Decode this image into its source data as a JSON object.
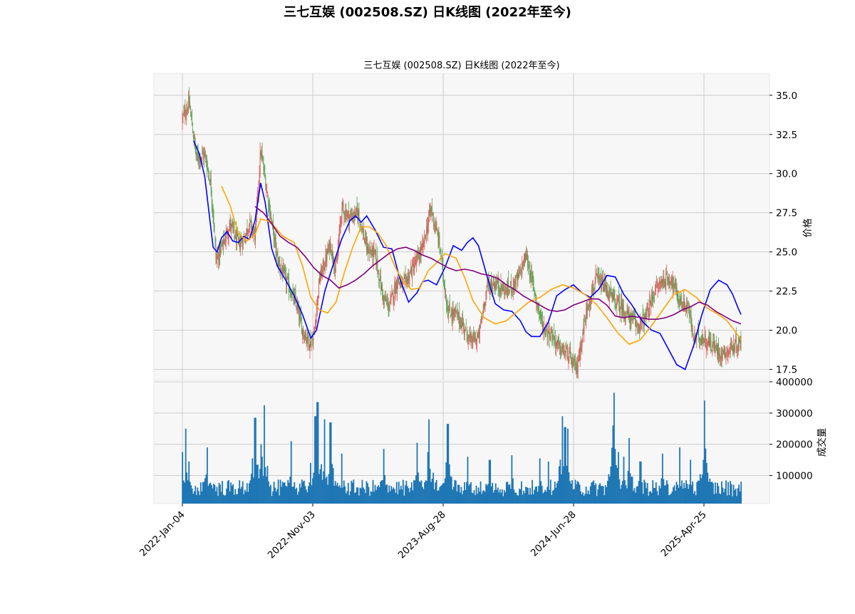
{
  "figure": {
    "suptitle": "三七互娱 (002508.SZ) 日K线图 (2022年至今)"
  },
  "colors": {
    "up": "#e15759",
    "down": "#59a14f",
    "ma_short": "#0000ff",
    "ma_mid": "#ffa500",
    "ma_long": "#800080",
    "volume": "#1f77b4",
    "panel_bg": "#f7f7f7",
    "grid": "#cccccc"
  },
  "chart_data": [
    {
      "type": "candlestick",
      "title": "三七互娱 (002508.SZ) 日K线图 (2022年至今)",
      "ylabel": "价格",
      "ylim": [
        16.8,
        36.4
      ],
      "yticks": [
        17.5,
        20.0,
        22.5,
        25.0,
        27.5,
        30.0,
        32.5,
        35.0
      ],
      "ytick_labels": [
        "17.5",
        "20.0",
        "22.5",
        "25.0",
        "27.5",
        "30.0",
        "32.5",
        "35.0"
      ],
      "grid": true,
      "x_labels": [
        "2022-Jan-04",
        "2022-Nov-03",
        "2023-Aug-28",
        "2024-Jun-28",
        "2025-Apr-25"
      ],
      "close_series": {
        "name": "close",
        "t": [
          0,
          0.012,
          0.025,
          0.04,
          0.05,
          0.055,
          0.06,
          0.07,
          0.085,
          0.1,
          0.11,
          0.12,
          0.13,
          0.14,
          0.155,
          0.17,
          0.19,
          0.205,
          0.215,
          0.228,
          0.235,
          0.245,
          0.265,
          0.275,
          0.285,
          0.3,
          0.315,
          0.33,
          0.345,
          0.36,
          0.37,
          0.385,
          0.395,
          0.41,
          0.43,
          0.445,
          0.46,
          0.475,
          0.49,
          0.505,
          0.515,
          0.53,
          0.545,
          0.56,
          0.58,
          0.6,
          0.615,
          0.63,
          0.645,
          0.66,
          0.675,
          0.69,
          0.705,
          0.725,
          0.74,
          0.755,
          0.77,
          0.785,
          0.8,
          0.815,
          0.83,
          0.845,
          0.86,
          0.875,
          0.89,
          0.905,
          0.915,
          0.925,
          0.935,
          0.95,
          0.965,
          0.98,
          1.0
        ],
        "values": [
          33.5,
          34.5,
          31.0,
          31.2,
          29.5,
          27.5,
          24.5,
          25.2,
          26.8,
          25.5,
          25.8,
          26.9,
          26.0,
          31.5,
          28.0,
          24.5,
          22.8,
          21.5,
          20.0,
          19.2,
          19.5,
          23.2,
          25.5,
          23.8,
          27.8,
          27.2,
          27.5,
          25.2,
          24.8,
          22.0,
          21.5,
          23.2,
          22.8,
          23.8,
          25.2,
          27.8,
          25.5,
          21.2,
          21.0,
          20.2,
          19.3,
          19.5,
          22.8,
          23.0,
          22.5,
          23.2,
          24.8,
          22.5,
          20.2,
          19.8,
          18.8,
          18.5,
          17.4,
          21.5,
          23.2,
          22.8,
          22.0,
          21.5,
          20.8,
          20.3,
          20.8,
          22.5,
          23.2,
          23.3,
          21.8,
          21.5,
          19.5,
          19.6,
          19.4,
          19.0,
          18.5,
          18.8,
          19.2
        ]
      },
      "series": [
        {
          "color": "#0000ff",
          "t": [
            0.02,
            0.03,
            0.04,
            0.05,
            0.055,
            0.062,
            0.07,
            0.08,
            0.09,
            0.1,
            0.11,
            0.12,
            0.13,
            0.14,
            0.148,
            0.16,
            0.17,
            0.185,
            0.2,
            0.215,
            0.23,
            0.24,
            0.255,
            0.27,
            0.285,
            0.3,
            0.31,
            0.32,
            0.33,
            0.345,
            0.36,
            0.375,
            0.39,
            0.405,
            0.42,
            0.43,
            0.44,
            0.455,
            0.47,
            0.485,
            0.5,
            0.51,
            0.52,
            0.53,
            0.545,
            0.56,
            0.575,
            0.59,
            0.605,
            0.615,
            0.625,
            0.64,
            0.655,
            0.67,
            0.685,
            0.7,
            0.715,
            0.73,
            0.745,
            0.76,
            0.775,
            0.79,
            0.805,
            0.815,
            0.825,
            0.84,
            0.855,
            0.87,
            0.885,
            0.9,
            0.915,
            0.93,
            0.945,
            0.96,
            0.975,
            0.985,
            0.995,
            1.0
          ],
          "values": [
            32.1,
            31.3,
            29.8,
            26.8,
            25.3,
            25.0,
            25.9,
            26.3,
            25.7,
            25.6,
            26.0,
            25.8,
            27.0,
            29.4,
            28.2,
            25.2,
            24.1,
            23.2,
            22.2,
            21.0,
            19.5,
            20.0,
            22.5,
            24.2,
            25.8,
            27.0,
            27.3,
            26.9,
            27.3,
            26.4,
            25.3,
            25.2,
            23.2,
            21.8,
            22.4,
            23.1,
            23.2,
            22.9,
            24.0,
            25.4,
            25.1,
            25.6,
            25.9,
            25.4,
            23.5,
            21.7,
            21.3,
            21.2,
            20.6,
            19.9,
            19.6,
            19.6,
            20.5,
            22.2,
            22.6,
            22.9,
            22.4,
            22.1,
            22.6,
            23.5,
            23.4,
            22.3,
            21.6,
            21.0,
            20.5,
            20.0,
            19.8,
            18.8,
            17.8,
            17.5,
            19.0,
            21.0,
            22.6,
            23.2,
            22.9,
            22.3,
            21.4,
            21.0
          ],
          "name": ""
        },
        {
          "color": "#ffa500",
          "t": [
            0.07,
            0.085,
            0.1,
            0.115,
            0.13,
            0.14,
            0.152,
            0.165,
            0.18,
            0.2,
            0.215,
            0.23,
            0.245,
            0.26,
            0.275,
            0.29,
            0.305,
            0.32,
            0.335,
            0.35,
            0.365,
            0.38,
            0.395,
            0.41,
            0.425,
            0.44,
            0.455,
            0.47,
            0.49,
            0.505,
            0.52,
            0.54,
            0.56,
            0.58,
            0.6,
            0.62,
            0.64,
            0.66,
            0.68,
            0.7,
            0.72,
            0.74,
            0.76,
            0.78,
            0.8,
            0.82,
            0.84,
            0.86,
            0.88,
            0.9,
            0.92,
            0.94,
            0.96,
            0.975,
            0.99,
            1.0
          ],
          "values": [
            29.2,
            28.0,
            26.2,
            25.7,
            26.1,
            27.1,
            27.0,
            26.6,
            26.0,
            25.6,
            24.1,
            22.1,
            21.3,
            21.1,
            21.8,
            23.7,
            25.3,
            26.6,
            26.6,
            26.2,
            25.4,
            24.1,
            23.1,
            22.6,
            22.7,
            23.8,
            24.3,
            24.9,
            24.6,
            23.4,
            21.9,
            20.8,
            20.4,
            20.6,
            21.2,
            21.8,
            22.1,
            22.6,
            22.9,
            22.7,
            22.3,
            21.7,
            20.8,
            19.8,
            19.1,
            19.4,
            20.3,
            21.3,
            22.3,
            22.6,
            22.1,
            21.4,
            21.0,
            20.6,
            19.9,
            19.4
          ],
          "name": ""
        },
        {
          "color": "#800080",
          "t": [
            0.13,
            0.145,
            0.16,
            0.175,
            0.19,
            0.205,
            0.22,
            0.235,
            0.25,
            0.265,
            0.28,
            0.295,
            0.31,
            0.325,
            0.34,
            0.355,
            0.37,
            0.385,
            0.4,
            0.415,
            0.43,
            0.445,
            0.46,
            0.475,
            0.49,
            0.505,
            0.52,
            0.535,
            0.55,
            0.565,
            0.58,
            0.595,
            0.61,
            0.625,
            0.64,
            0.655,
            0.67,
            0.685,
            0.7,
            0.715,
            0.73,
            0.745,
            0.76,
            0.775,
            0.79,
            0.805,
            0.82,
            0.835,
            0.85,
            0.865,
            0.88,
            0.895,
            0.91,
            0.925,
            0.94,
            0.955,
            0.97,
            0.985,
            1.0
          ],
          "values": [
            27.9,
            27.5,
            26.8,
            26.0,
            25.6,
            25.3,
            24.7,
            24.0,
            23.5,
            23.2,
            22.7,
            22.9,
            23.2,
            23.6,
            24.1,
            24.5,
            24.9,
            25.2,
            25.3,
            25.1,
            24.8,
            24.6,
            24.3,
            24.0,
            23.8,
            23.9,
            23.8,
            23.6,
            23.5,
            23.3,
            22.9,
            22.6,
            22.2,
            21.9,
            21.6,
            21.3,
            21.2,
            21.3,
            21.6,
            21.8,
            22.0,
            22.0,
            21.6,
            20.9,
            20.8,
            20.9,
            20.8,
            20.7,
            20.7,
            20.8,
            21.0,
            21.3,
            21.5,
            21.8,
            21.6,
            21.2,
            20.9,
            20.6,
            20.4
          ],
          "name": ""
        }
      ]
    },
    {
      "type": "bar",
      "ylabel": "成交量",
      "ylim": [
        10000,
        400000
      ],
      "yticks": [
        100000,
        200000,
        300000,
        400000
      ],
      "ytick_labels": [
        "100000",
        "200000",
        "300000",
        "400000"
      ],
      "grid": true,
      "baseline_volume": 60000,
      "spikes": [
        {
          "t": 0.0,
          "value": 175000
        },
        {
          "t": 0.006,
          "value": 250000
        },
        {
          "t": 0.012,
          "value": 145000
        },
        {
          "t": 0.045,
          "value": 190000
        },
        {
          "t": 0.125,
          "value": 155000
        },
        {
          "t": 0.13,
          "value": 285000
        },
        {
          "t": 0.14,
          "value": 200000
        },
        {
          "t": 0.147,
          "value": 325000
        },
        {
          "t": 0.195,
          "value": 210000
        },
        {
          "t": 0.23,
          "value": 140000
        },
        {
          "t": 0.238,
          "value": 290000
        },
        {
          "t": 0.242,
          "value": 335000
        },
        {
          "t": 0.255,
          "value": 280000
        },
        {
          "t": 0.265,
          "value": 270000
        },
        {
          "t": 0.285,
          "value": 170000
        },
        {
          "t": 0.36,
          "value": 185000
        },
        {
          "t": 0.42,
          "value": 205000
        },
        {
          "t": 0.44,
          "value": 175000
        },
        {
          "t": 0.442,
          "value": 280000
        },
        {
          "t": 0.475,
          "value": 265000
        },
        {
          "t": 0.51,
          "value": 160000
        },
        {
          "t": 0.55,
          "value": 150000
        },
        {
          "t": 0.59,
          "value": 165000
        },
        {
          "t": 0.64,
          "value": 155000
        },
        {
          "t": 0.655,
          "value": 145000
        },
        {
          "t": 0.68,
          "value": 290000
        },
        {
          "t": 0.685,
          "value": 255000
        },
        {
          "t": 0.69,
          "value": 250000
        },
        {
          "t": 0.79,
          "value": 160000
        },
        {
          "t": 0.8,
          "value": 220000
        },
        {
          "t": 0.775,
          "value": 165000
        },
        {
          "t": 0.77,
          "value": 260000
        },
        {
          "t": 0.772,
          "value": 365000
        },
        {
          "t": 0.78,
          "value": 175000
        },
        {
          "t": 0.82,
          "value": 145000
        },
        {
          "t": 0.86,
          "value": 170000
        },
        {
          "t": 0.89,
          "value": 190000
        },
        {
          "t": 0.91,
          "value": 150000
        },
        {
          "t": 0.935,
          "value": 340000
        },
        {
          "t": 0.938,
          "value": 140000
        }
      ]
    }
  ]
}
